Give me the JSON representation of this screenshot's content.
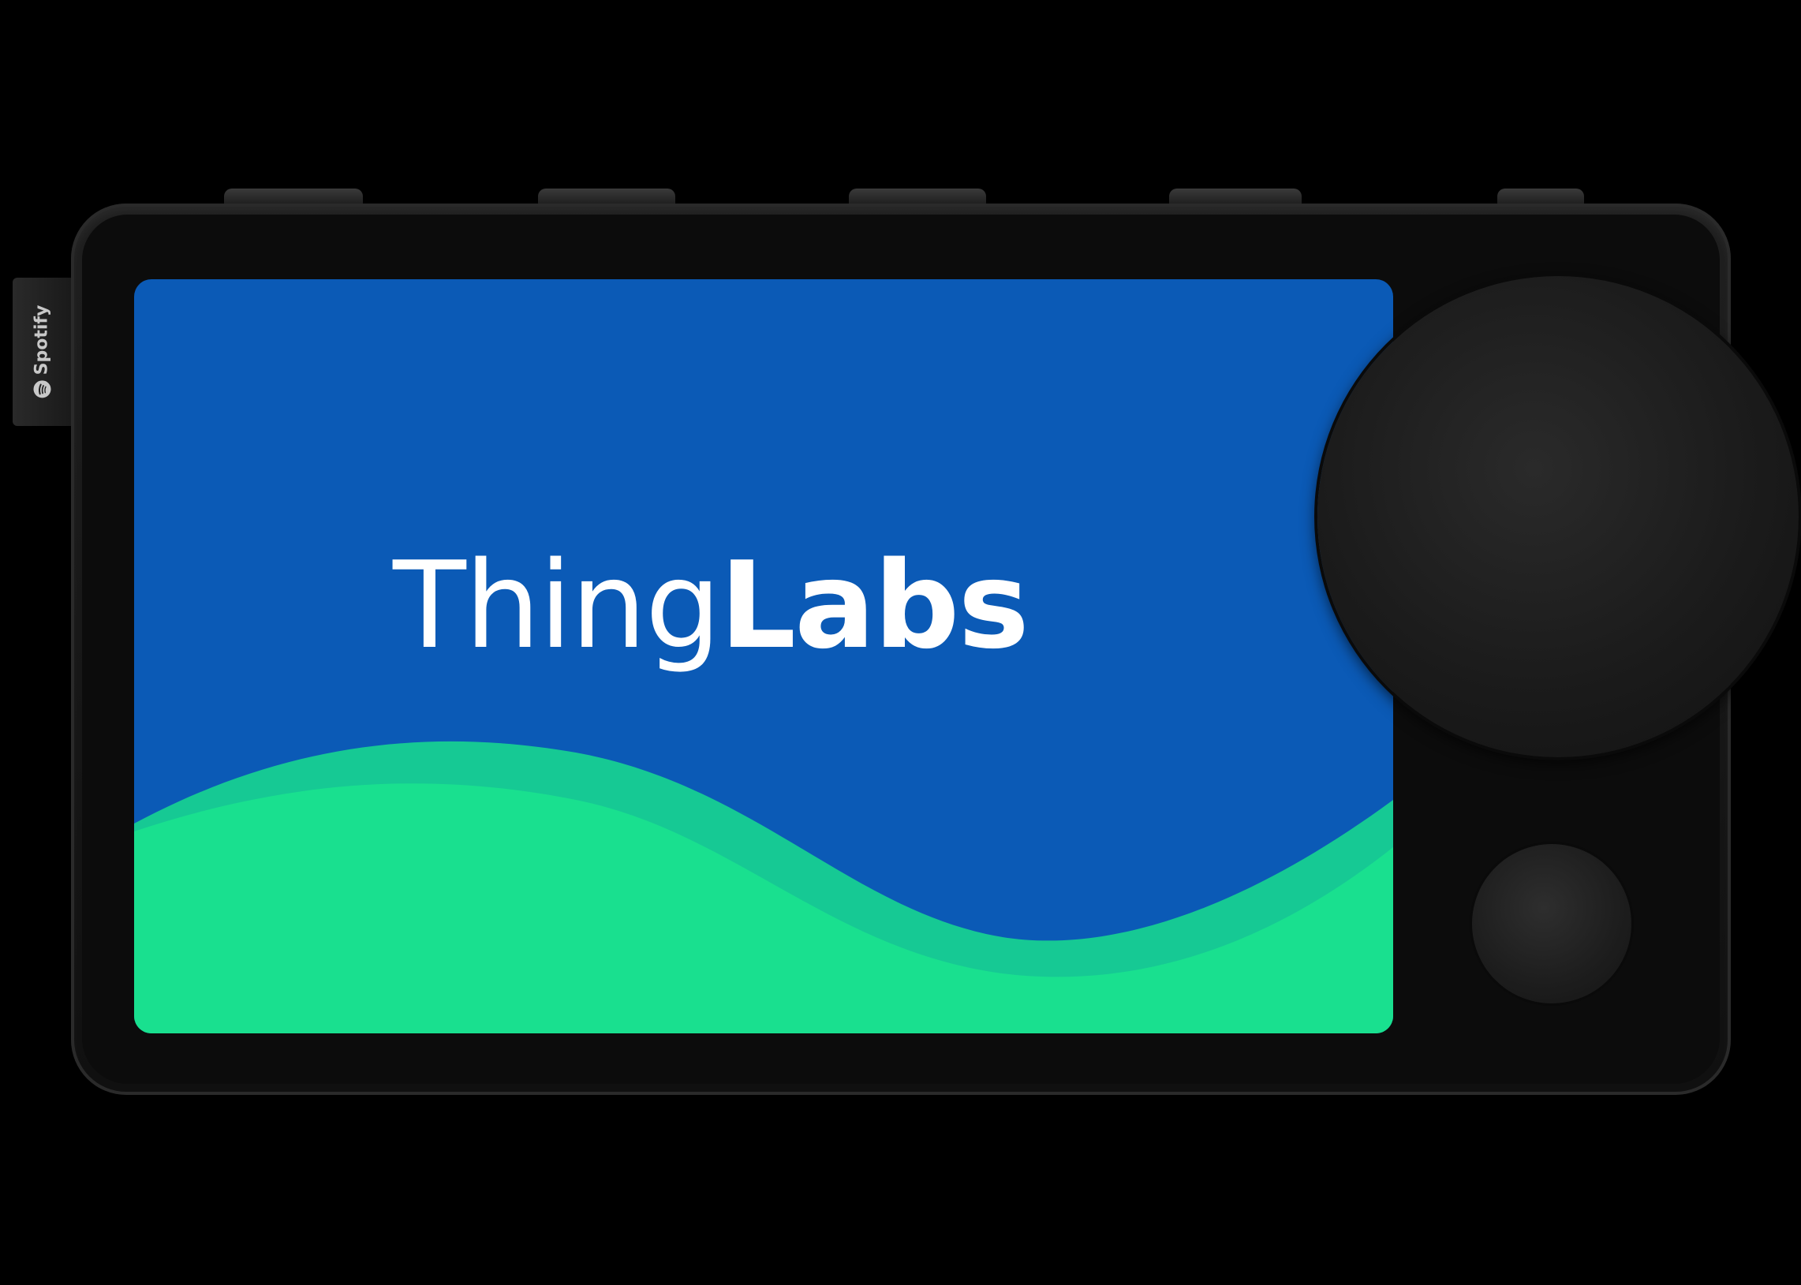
{
  "brand": {
    "logo_regular": "Thing",
    "logo_bold": "Labs",
    "side_tag": "Spotify"
  },
  "colors": {
    "screen_blue": "#0b5ab6",
    "wave_green": "#19e08f",
    "wave_green_dark": "#16c994",
    "device_black": "#111111"
  },
  "icons": {
    "side_tag_icon": "spotify-icon"
  }
}
